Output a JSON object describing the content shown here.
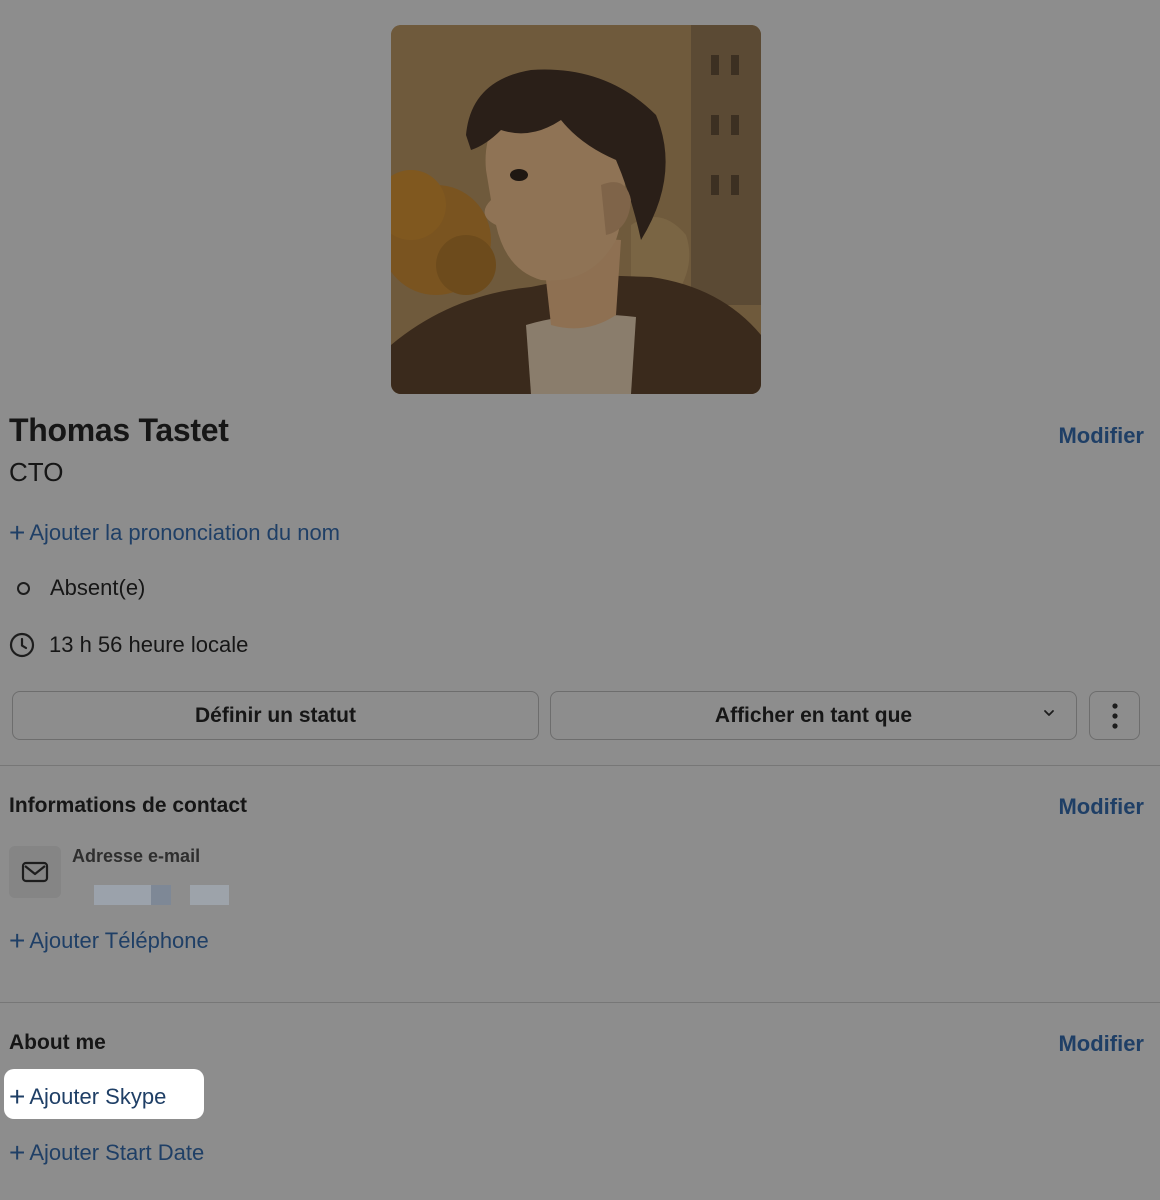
{
  "profile": {
    "name": "Thomas Tastet",
    "title": "CTO",
    "edit_label": "Modifier",
    "add_pronunciation": "Ajouter la prononciation du nom",
    "presence": "Absent(e)",
    "local_time": "13 h 56 heure locale"
  },
  "actions": {
    "set_status": "Définir un statut",
    "view_as": "Afficher en tant que"
  },
  "contact": {
    "heading": "Informations de contact",
    "edit_label": "Modifier",
    "email_label": "Adresse e-mail",
    "add_phone": "Ajouter Téléphone"
  },
  "about": {
    "heading": "About me",
    "edit_label": "Modifier",
    "add_skype": "Ajouter Skype",
    "add_start_date": "Ajouter Start Date"
  },
  "plus_glyph": "+",
  "colors": {
    "background": "#8d8d8d",
    "link": "#1f3f66",
    "highlight": "#ffffff"
  },
  "icons": {
    "presence": "presence-away-icon",
    "clock": "clock-icon",
    "chevron": "chevron-down-icon",
    "more": "more-vertical-icon",
    "mail": "mail-icon",
    "plus": "plus-icon"
  }
}
